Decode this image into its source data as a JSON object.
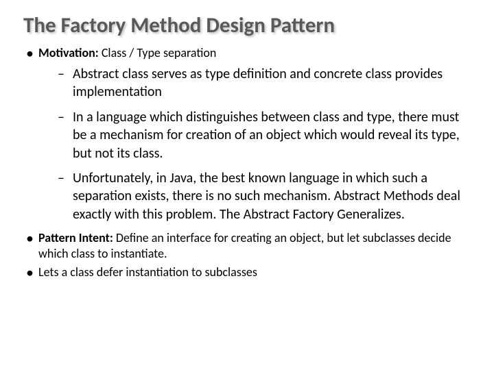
{
  "title": "The Factory Method Design Pattern",
  "bullet1": {
    "label": "Motivation:",
    "text": " Class / Type separation",
    "sub1": "Abstract class serves as type definition and concrete class provides implementation",
    "sub2": "In a language which distinguishes between class and type, there must be a  mechanism for creation of an object which would reveal its type, but not its class.",
    "sub3": "Unfortunately, in Java, the best known language in which such a separation exists, there is  no such mechanism. Abstract Methods deal exactly with this problem. The Abstract Factory Generalizes."
  },
  "bullet2": {
    "label": "Pattern Intent:",
    "text": " Define an interface for creating an object, but let subclasses decide which class to instantiate."
  },
  "bullet3": {
    "text": "Lets a class defer instantiation to subclasses"
  }
}
